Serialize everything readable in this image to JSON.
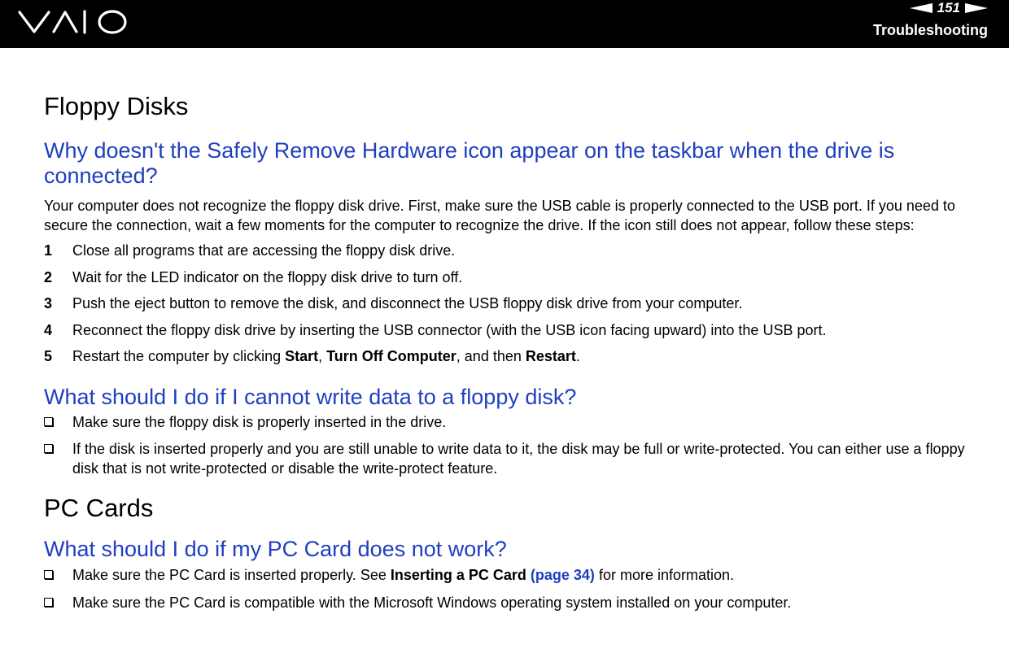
{
  "header": {
    "logo_text": "VAIO",
    "page_number": "151",
    "section": "Troubleshooting"
  },
  "floppy": {
    "title": "Floppy Disks",
    "q1": {
      "title": "Why doesn't the Safely Remove Hardware icon appear on the taskbar when the drive is connected?",
      "intro": "Your computer does not recognize the floppy disk drive. First, make sure the USB cable is properly connected to the USB port. If you need to secure the connection, wait a few moments for the computer to recognize the drive. If the icon still does not appear, follow these steps:",
      "steps": [
        {
          "num": "1",
          "text": "Close all programs that are accessing the floppy disk drive."
        },
        {
          "num": "2",
          "text": "Wait for the LED indicator on the floppy disk drive to turn off."
        },
        {
          "num": "3",
          "text": "Push the eject button to remove the disk, and disconnect the USB floppy disk drive from your computer."
        },
        {
          "num": "4",
          "text": "Reconnect the floppy disk drive by inserting the USB connector (with the USB icon facing upward) into the USB port."
        }
      ],
      "step5": {
        "num": "5",
        "pre": "Restart the computer by clicking ",
        "start": "Start",
        "sep": ", ",
        "turn_off": "Turn Off Computer",
        "mid": ", and then ",
        "restart": "Restart",
        "end": "."
      }
    },
    "q2": {
      "title": "What should I do if I cannot write data to a floppy disk?",
      "items": [
        "Make sure the floppy disk is properly inserted in the drive.",
        "If the disk is inserted properly and you are still unable to write data to it, the disk may be full or write-protected. You can either use a floppy disk that is not write-protected or disable the write-protect feature."
      ]
    }
  },
  "pccards": {
    "title": "PC Cards",
    "q1": {
      "title": "What should I do if my PC Card does not work?",
      "item1": {
        "pre": "Make sure the PC Card is inserted properly. See ",
        "bold": "Inserting a PC Card",
        "link": "(page 34)",
        "post": " for more information."
      },
      "item2": "Make sure the PC Card is compatible with the Microsoft Windows operating system installed on your computer."
    }
  },
  "colors": {
    "header_bg": "#000000",
    "heading_blue": "#1f3fbf"
  },
  "icons": {
    "prev": "left-arrow-icon",
    "next": "right-arrow-icon",
    "bullet": "checkbox-bullet-icon"
  }
}
